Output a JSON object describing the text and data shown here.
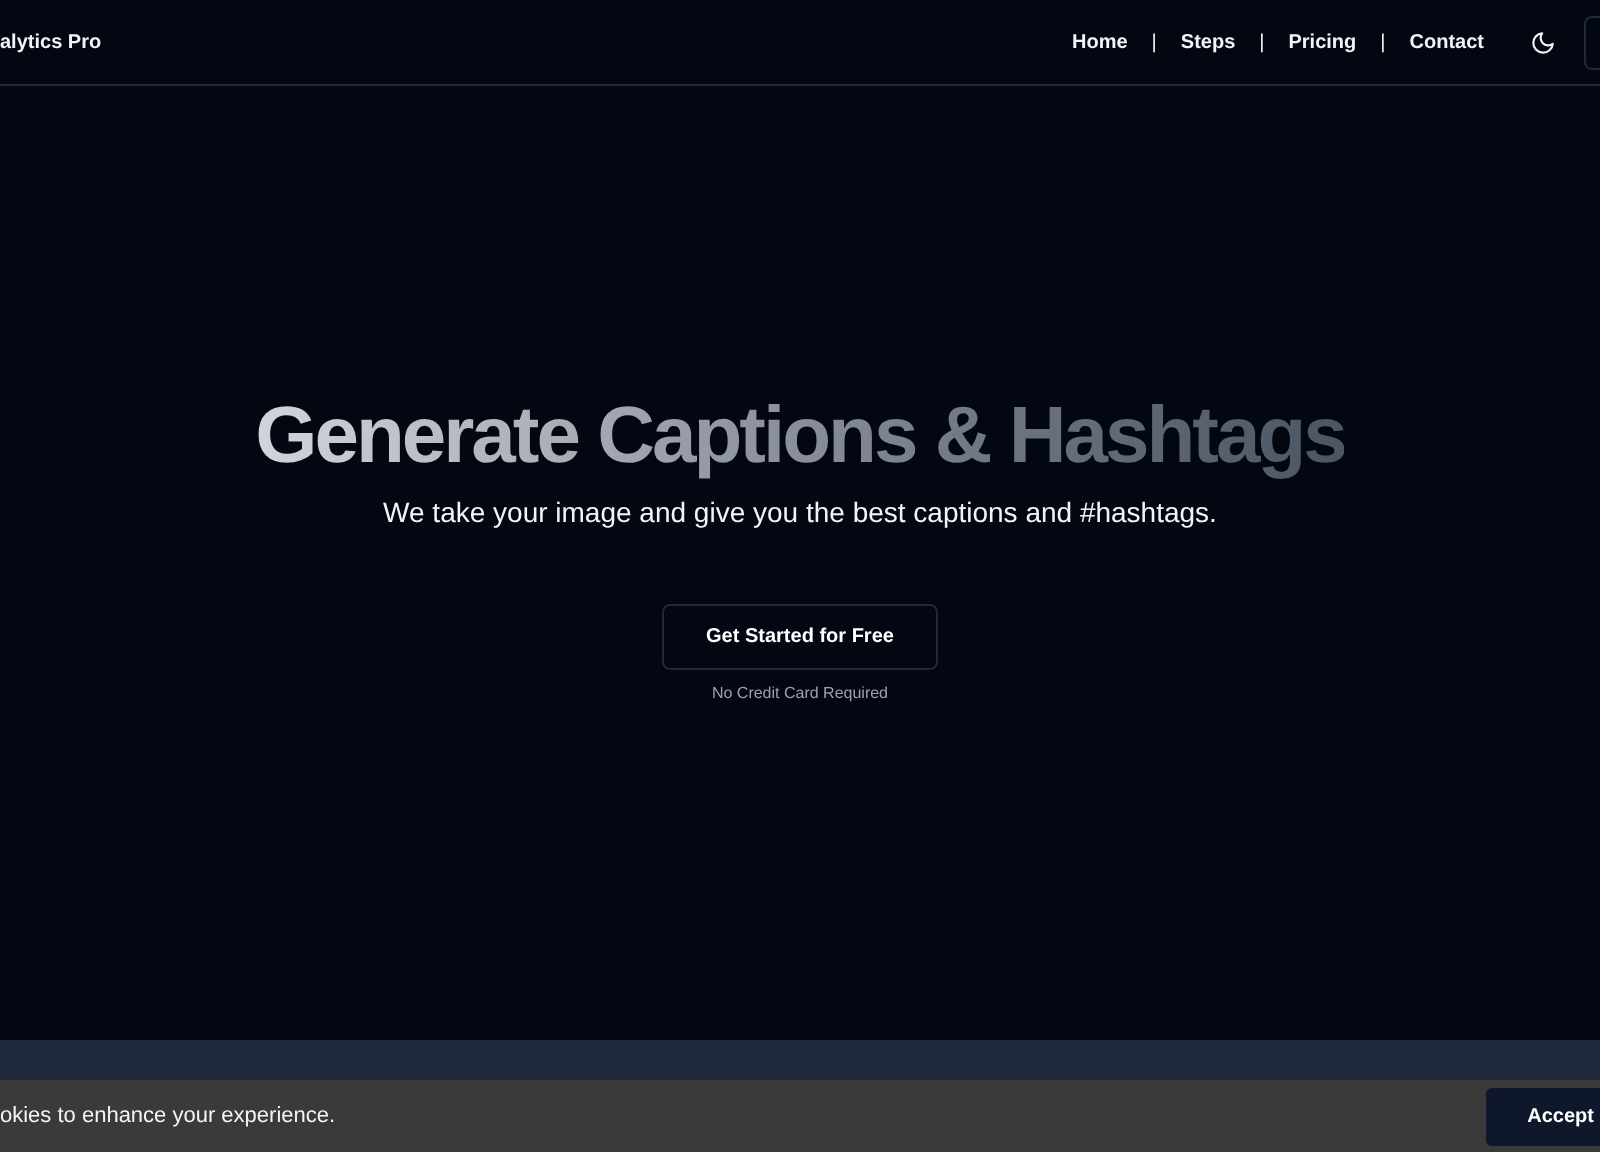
{
  "navbar": {
    "brand": "alytics Pro",
    "links": [
      {
        "label": "Home"
      },
      {
        "label": "Steps"
      },
      {
        "label": "Pricing"
      },
      {
        "label": "Contact"
      }
    ],
    "separator": "|"
  },
  "hero": {
    "title": "Generate Captions & Hashtags",
    "subtitle": "We take your image and give you the best captions and #hashtags.",
    "button": "Get Started for Free",
    "note": "No Credit Card Required"
  },
  "cookie_bar": {
    "text": "okies to enhance your experience.",
    "button": "Accept"
  }
}
